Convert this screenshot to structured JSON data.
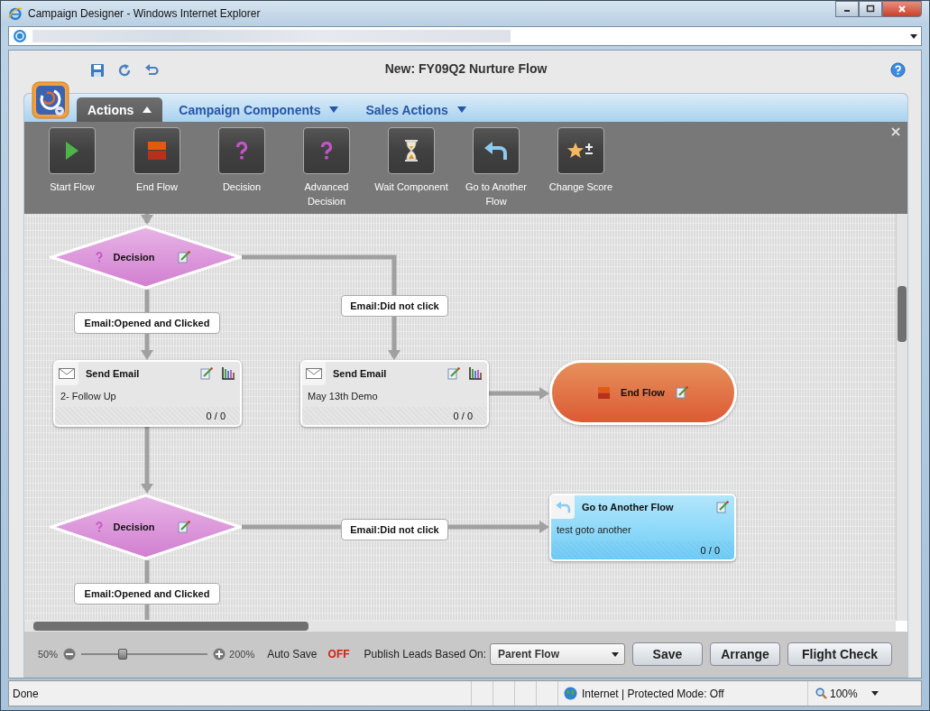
{
  "window": {
    "title": "Campaign Designer - Windows Internet Explorer"
  },
  "page": {
    "title": "New: FY09Q2 Nurture Flow"
  },
  "tabs": [
    {
      "label": "Actions",
      "selected": true
    },
    {
      "label": "Campaign Components",
      "selected": false
    },
    {
      "label": "Sales Actions",
      "selected": false
    }
  ],
  "palette": [
    {
      "kind": "start",
      "label": "Start Flow"
    },
    {
      "kind": "end",
      "label": "End Flow"
    },
    {
      "kind": "decision",
      "label": "Decision"
    },
    {
      "kind": "decision",
      "label": "Advanced Decision"
    },
    {
      "kind": "wait",
      "label": "Wait Component"
    },
    {
      "kind": "goto",
      "label": "Go to Another Flow"
    },
    {
      "kind": "score",
      "label": "Change Score"
    }
  ],
  "flow": {
    "nodes": [
      {
        "kind": "decision",
        "title": "Decision"
      },
      {
        "kind": "send_email",
        "title": "Send Email",
        "detail": "2- Follow Up",
        "count": "0 / 0"
      },
      {
        "kind": "send_email",
        "title": "Send Email",
        "detail": "May 13th Demo",
        "count": "0 / 0"
      },
      {
        "kind": "end_flow",
        "title": "End Flow"
      },
      {
        "kind": "decision",
        "title": "Decision"
      },
      {
        "kind": "goto_flow",
        "title": "Go to Another Flow",
        "detail": "test goto another",
        "count": "0 / 0"
      }
    ],
    "branch_labels": [
      {
        "text": "Email:Opened and Clicked"
      },
      {
        "text": "Email:Did not click"
      },
      {
        "text": "Email:Did not click"
      },
      {
        "text": "Email:Opened and Clicked"
      }
    ]
  },
  "zoom": {
    "min": "50%",
    "max": "200%",
    "level": 0.33
  },
  "auto_save": {
    "label": "Auto Save",
    "value": "OFF"
  },
  "publish": {
    "label": "Publish Leads Based On:",
    "value": "Parent Flow"
  },
  "buttons": [
    "Save",
    "Arrange",
    "Flight Check"
  ],
  "status_bar": {
    "text": "Done",
    "zone": "Internet | Protected Mode: Off",
    "zoom": "100%"
  }
}
